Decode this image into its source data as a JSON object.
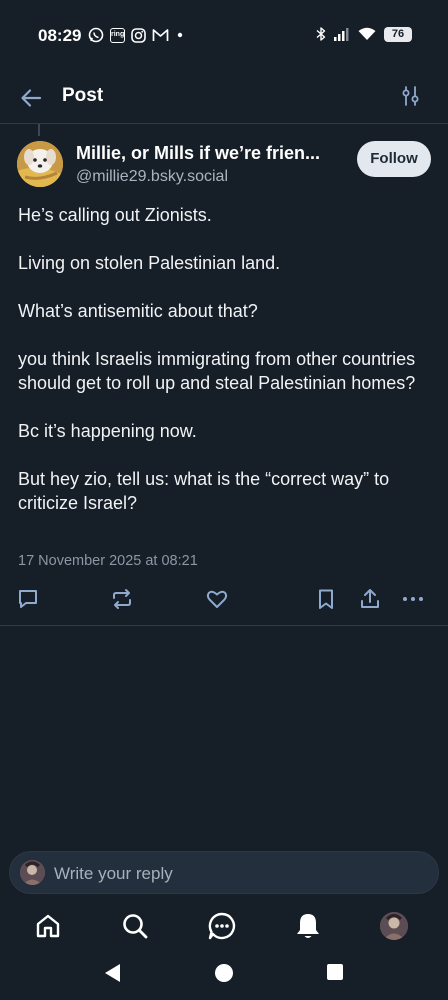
{
  "status_bar": {
    "time": "08:29",
    "battery": "76",
    "left_icons": [
      "whatsapp-icon",
      "ring-icon",
      "instagram-icon",
      "gmail-icon",
      "dot-icon"
    ],
    "right_icons": [
      "bluetooth-icon",
      "signal-icon",
      "wifi-icon",
      "battery-icon"
    ],
    "ring_label": "ring"
  },
  "header": {
    "title": "Post"
  },
  "post": {
    "author_name": "Millie, or Mills if we’re frien...",
    "author_handle": "@millie29.bsky.social",
    "follow_label": "Follow",
    "paragraphs": [
      "He’s calling out Zionists.",
      "Living on stolen Palestinian land.",
      "What’s antisemitic about that?",
      "you think Israelis immigrating from other countries should get to roll up and steal Palestinian homes?",
      "Bc it’s happening now.",
      "But hey zio, tell us:  what is the “correct way” to criticize Israel?"
    ],
    "date": "17 November 2025 at 08:21"
  },
  "reply": {
    "placeholder": "Write your reply"
  },
  "bottom_nav": {
    "items": [
      "home-icon",
      "search-icon",
      "chat-icon",
      "notifications-icon",
      "profile-avatar"
    ]
  },
  "colors": {
    "background": "#161e27",
    "divider": "#2e3a48",
    "muted_text": "#8b97a5",
    "icon_blue": "#8fa9cf",
    "follow_bg": "#e3e8ee"
  }
}
